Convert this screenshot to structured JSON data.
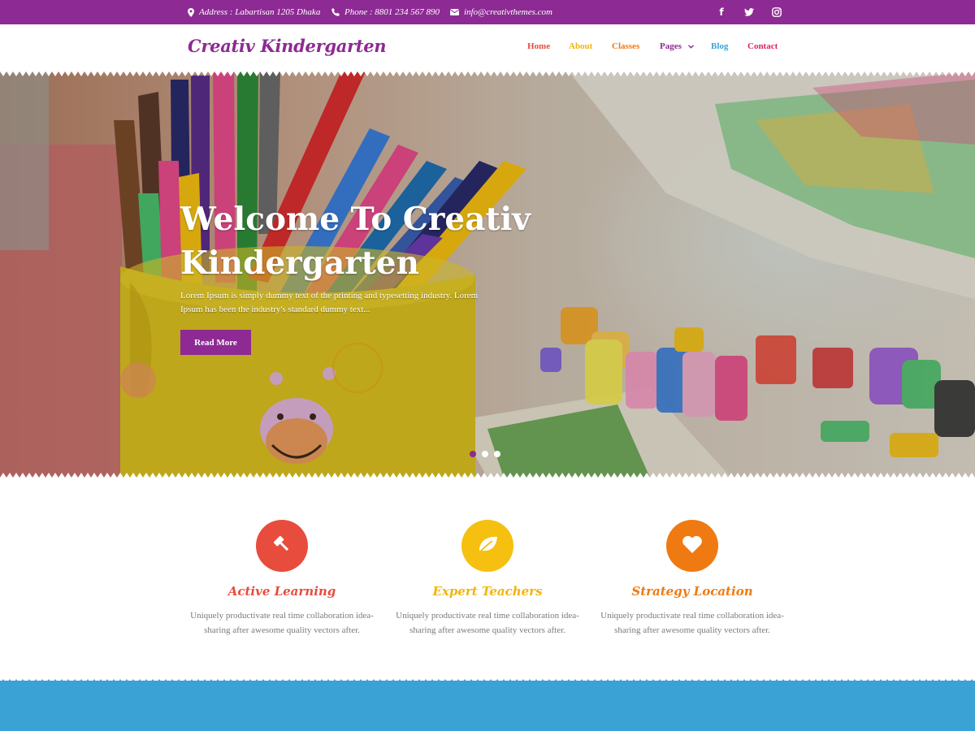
{
  "colors": {
    "brand": "#8d2a93",
    "home": "#e74c3c",
    "about": "#f1b40e",
    "classes": "#f07a12",
    "pages": "#8d2a93",
    "blog": "#3aa2d5",
    "contact": "#e0245e",
    "feature1": "#e74c3c",
    "feature2": "#f5c00f",
    "feature3": "#f07a12",
    "footer_band": "#3aa2d5"
  },
  "topbar": {
    "address": "Address : Labartisan 1205 Dhaka",
    "phone": "Phone : 8801 234 567 890",
    "email": "info@creativthemes.com",
    "social": [
      {
        "icon": "facebook-icon",
        "glyph": "f"
      },
      {
        "icon": "twitter-icon",
        "glyph": "t"
      },
      {
        "icon": "instagram-icon",
        "glyph": "◎"
      }
    ]
  },
  "header": {
    "brand": "Creativ Kindergarten",
    "nav": {
      "home": "Home",
      "about": "About",
      "classes": "Classes",
      "pages": "Pages",
      "blog": "Blog",
      "contact": "Contact"
    }
  },
  "hero": {
    "title": "Welcome To Creativ Kindergarten",
    "text": "Lorem Ipsum is simply dummy text of the printing and typesetting industry. Lorem Ipsum has been the industry's standard dummy text...",
    "button": "Read More",
    "slides_count": 3,
    "active_slide": 1
  },
  "features": [
    {
      "icon": "gavel-icon",
      "title": "Active Learning",
      "text": "Uniquely productivate real time collaboration idea-sharing after awesome quality vectors after."
    },
    {
      "icon": "leaf-icon",
      "title": "Expert Teachers",
      "text": "Uniquely productivate real time collaboration idea-sharing after awesome quality vectors after."
    },
    {
      "icon": "heart-icon",
      "title": "Strategy Location",
      "text": "Uniquely productivate real time collaboration idea-sharing after awesome quality vectors after."
    }
  ]
}
